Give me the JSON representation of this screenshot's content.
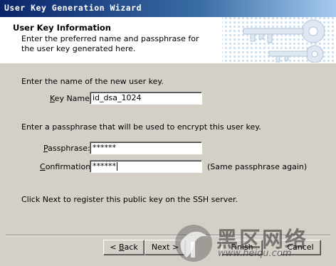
{
  "window": {
    "title": "User Key Generation Wizard"
  },
  "header": {
    "title": "User Key Information",
    "description": "Enter the preferred name and passphrase for the user key generated here."
  },
  "form": {
    "name_prompt": "Enter the name of the new user key.",
    "key_name_label": "Key Name:",
    "key_name_value": "id_dsa_1024",
    "pass_prompt": "Enter a passphrase that will be used to encrypt this user key.",
    "passphrase_label": "Passphrase:",
    "passphrase_value": "******",
    "confirmation_label": "Confirmation:",
    "confirmation_value": "******",
    "confirmation_hint": "(Same passphrase again)",
    "footer_text": "Click Next to register this public key on the SSH server."
  },
  "buttons": {
    "back": "< Back",
    "next": "Next >",
    "finish": "Finish",
    "cancel": "Cancel"
  },
  "watermark": {
    "chinese": "黑区网络",
    "url": "www.heiqu.com"
  },
  "colors": {
    "titlebar_start": "#0a246a",
    "titlebar_end": "#a6caf0",
    "dialog_bg": "#d4d0c8"
  }
}
